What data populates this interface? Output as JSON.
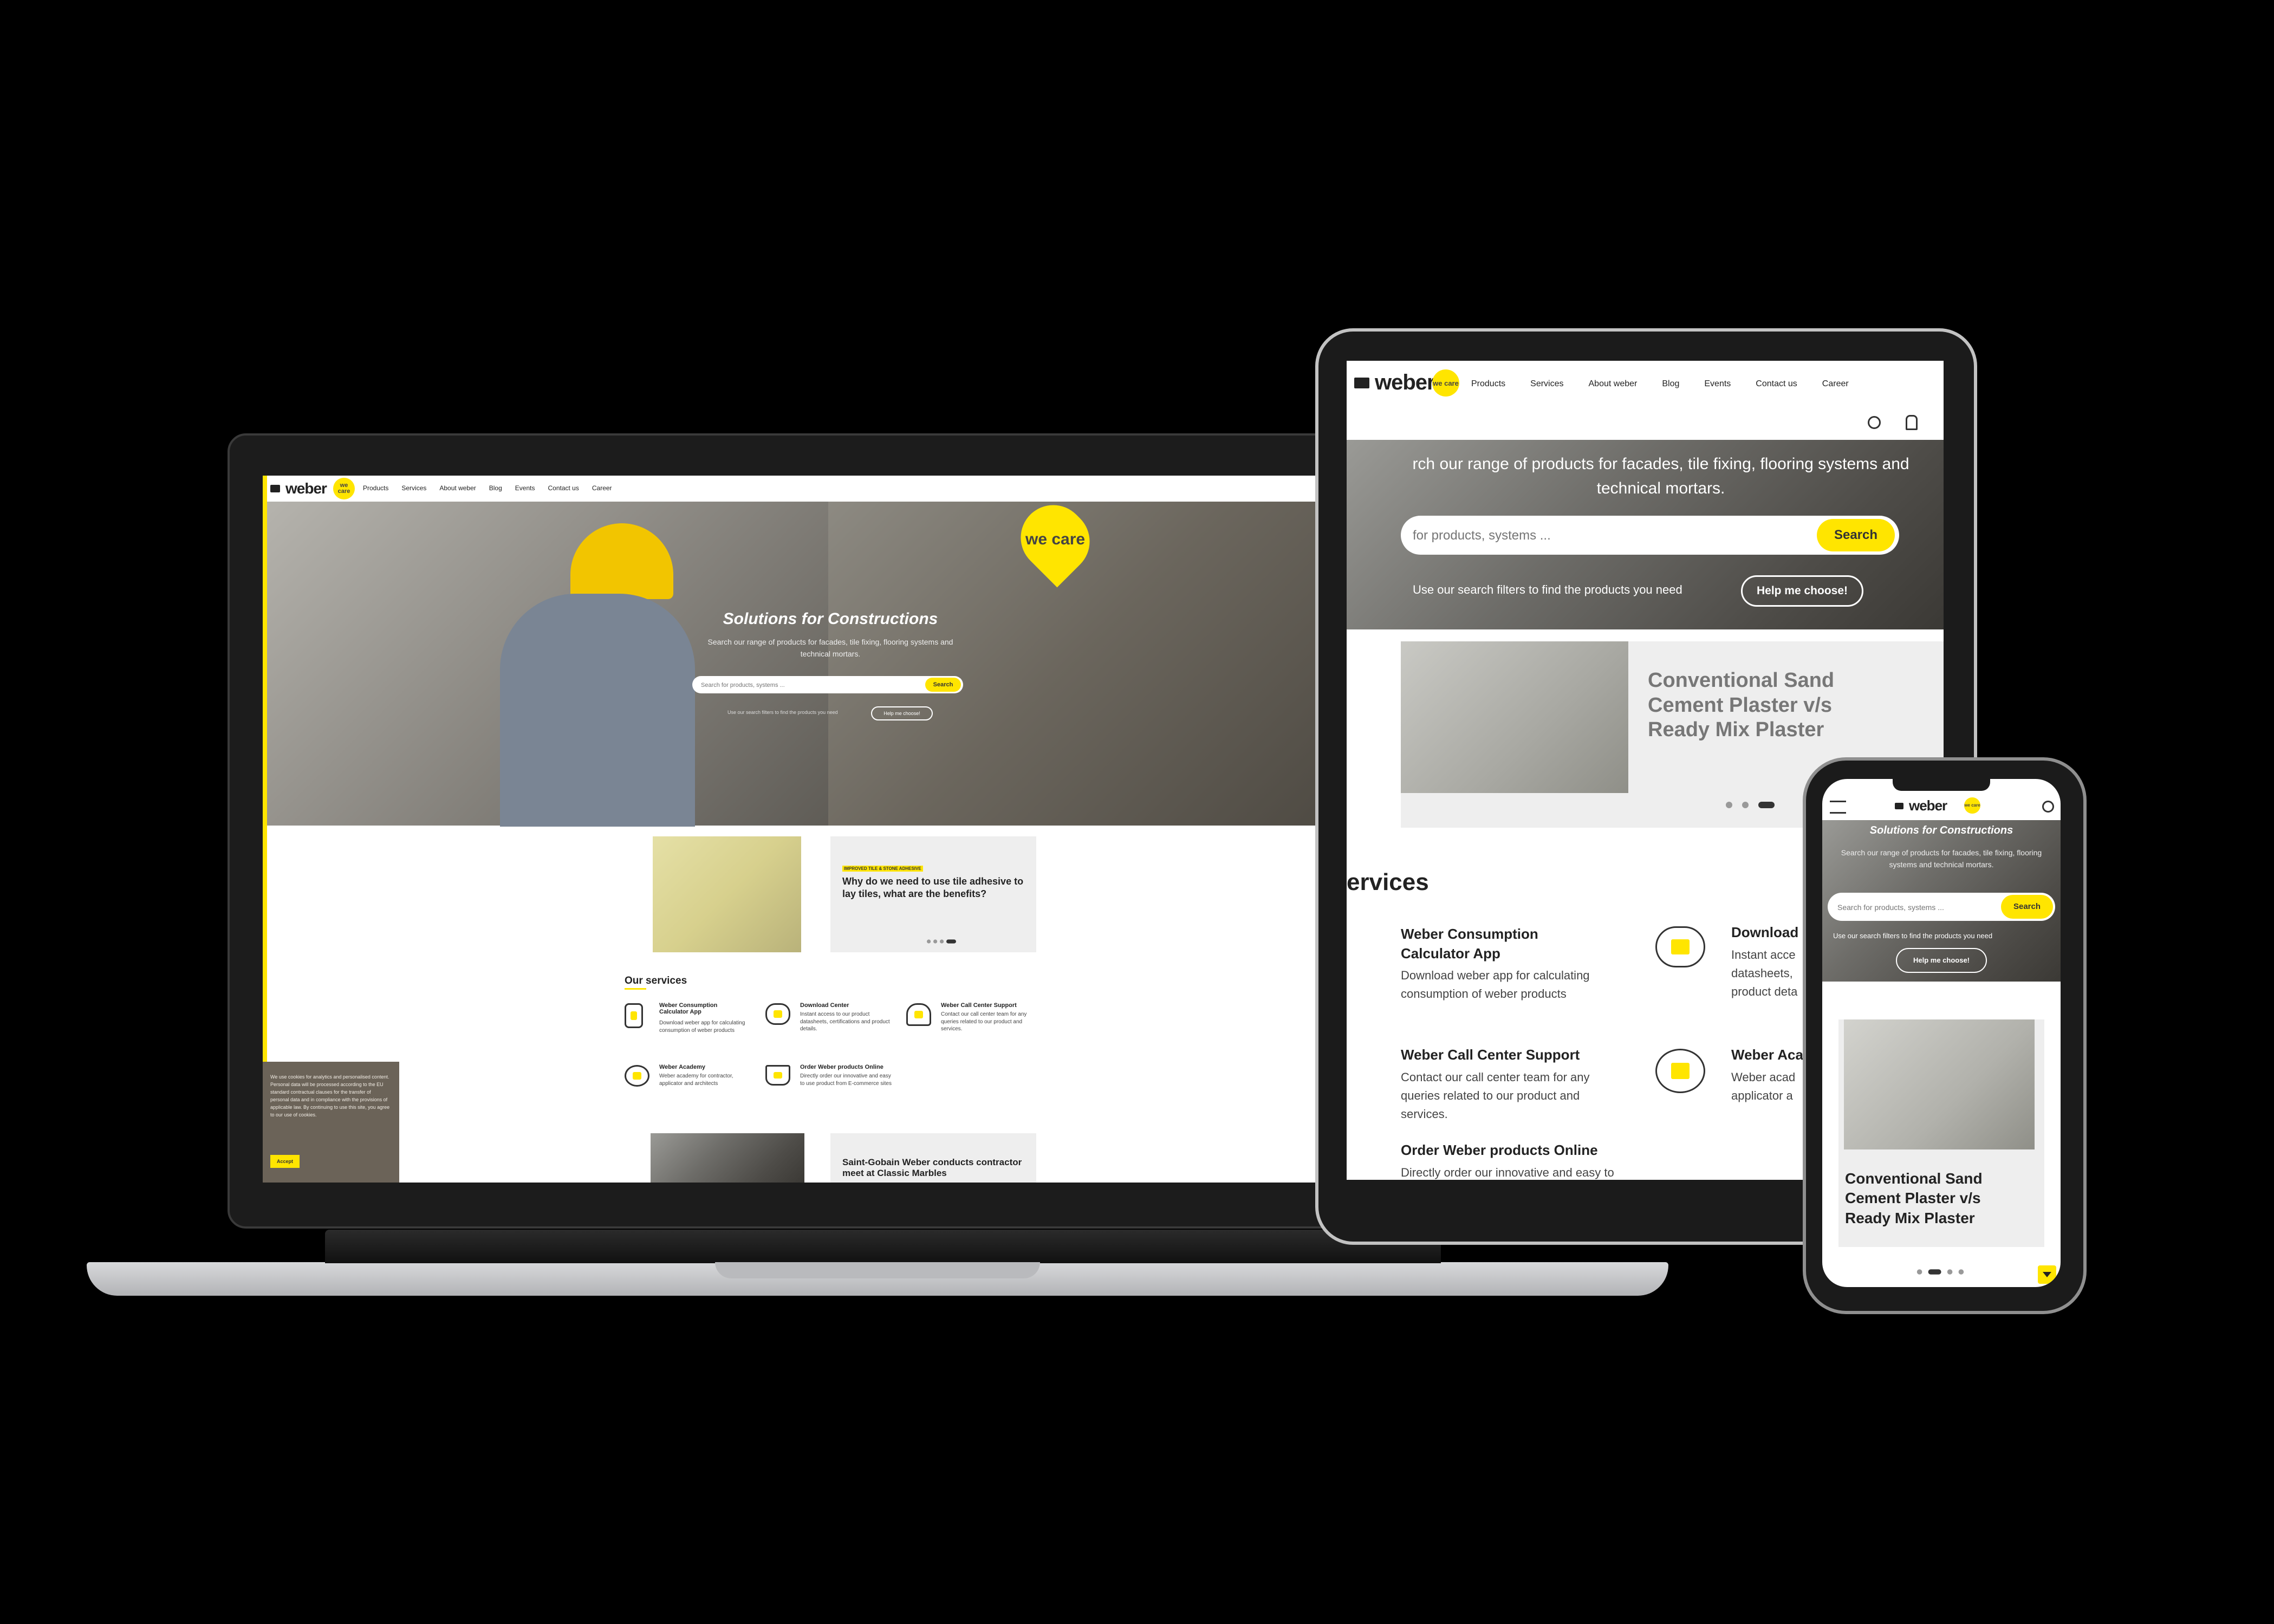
{
  "brand": {
    "logo_text": "weber",
    "we_care": "we care"
  },
  "nav": {
    "items": [
      "Products",
      "Services",
      "About weber",
      "Blog",
      "Events",
      "Contact us",
      "Career"
    ]
  },
  "hero": {
    "title": "Solutions for Constructions",
    "subtitle": "Search our range of products for facades, tile fixing, flooring systems and technical mortars.",
    "search_placeholder": "Search for products, systems ...",
    "search_button": "Search",
    "filter_text": "Use our search filters to find the products you need",
    "help_button": "Help me choose!"
  },
  "tablet": {
    "hero_subtitle_visible": "rch our range of products for facades, tile fixing, flooring systems and technical mortars.",
    "search_placeholder_visible": "for products, systems ...",
    "article_title": "Conventional Sand Cement Plaster v/s Ready Mix Plaster",
    "services_heading_visible": "ervices"
  },
  "articles": [
    {
      "tag": "IMPROVED TILE & STONE ADHESIVE",
      "title": "Why do we need to use tile adhesive to lay tiles, what are the benefits?"
    },
    {
      "tag": "",
      "title": "Saint-Gobain Weber conducts contractor meet at Classic Marbles"
    },
    {
      "tag": "",
      "title": "Conventional Sand Cement Plaster v/s Ready Mix Plaster"
    }
  ],
  "services": {
    "heading": "Our services",
    "items": [
      {
        "title": "Weber Consumption Calculator App",
        "desc": "Download weber app for calculating consumption of weber products",
        "icon": "calculator-icon"
      },
      {
        "title": "Download Center",
        "desc": "Instant access to our product datasheets, certifications and product details.",
        "icon": "cloud-download-icon"
      },
      {
        "title": "Weber Call Center Support",
        "desc": "Contact our call center team for any queries related to our product and services.",
        "icon": "headset-icon"
      },
      {
        "title": "Weber Academy",
        "desc": "Weber academy for contractor, applicator and architects",
        "icon": "academy-icon"
      },
      {
        "title": "Order Weber products Online",
        "desc": "Directly order our innovative and easy to use product from E-commerce sites",
        "icon": "cart-icon"
      }
    ],
    "tablet_partial": {
      "download_title_visible": "Download C",
      "download_desc_visible": "Instant acce datasheets, product deta",
      "academy_title_visible": "Weber Aca",
      "academy_desc_visible": "Weber acad applicator a",
      "order_desc_visible": "Directly order our innovative and easy to use product from E-"
    }
  },
  "cookie": {
    "text": "We use cookies for analytics and personalised content. Personal data will be processed according to the EU standard contractual clauses for the transfer of personal data and in compliance with the provisions of applicable law. By continuing to use this site, you agree to our use of cookies.",
    "accept": "Accept"
  },
  "colors": {
    "accent": "#ffe500",
    "dark": "#222222",
    "cookie_bg": "#6b6358",
    "card_bg": "#eeeeee"
  }
}
